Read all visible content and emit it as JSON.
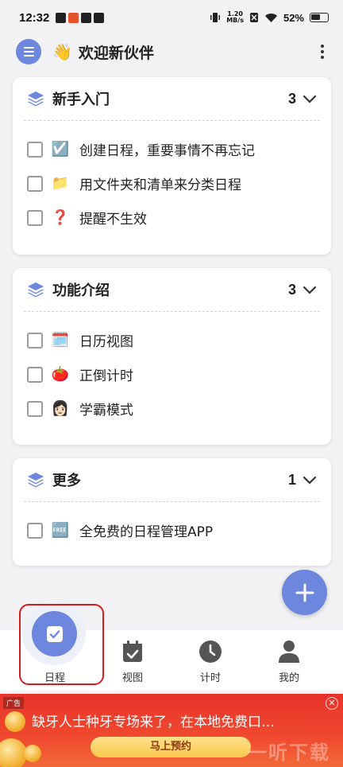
{
  "status_bar": {
    "time": "12:32",
    "net_speed_value": "1.20",
    "net_speed_unit": "MB/s",
    "battery": "52%"
  },
  "app_bar": {
    "wave_emoji": "👋",
    "title": "欢迎新伙伴",
    "menu_icon": "hamburger-icon",
    "more_icon": "more-vert-icon"
  },
  "sections": [
    {
      "title": "新手入门",
      "count": "3",
      "items": [
        {
          "emoji": "☑️",
          "label": "创建日程，重要事情不再忘记"
        },
        {
          "emoji": "📁",
          "label": "用文件夹和清单来分类日程"
        },
        {
          "emoji": "❓",
          "label": "提醒不生效"
        }
      ]
    },
    {
      "title": "功能介绍",
      "count": "3",
      "items": [
        {
          "emoji": "🗓️",
          "label": "日历视图"
        },
        {
          "emoji": "🍅",
          "label": "正倒计时"
        },
        {
          "emoji": "👩🏻",
          "label": "学霸模式"
        }
      ]
    },
    {
      "title": "更多",
      "count": "1",
      "items": [
        {
          "emoji": "🆓",
          "label": "全免费的日程管理APP"
        }
      ]
    }
  ],
  "bottom_nav": [
    {
      "label": "日程",
      "icon": "schedule-check-icon",
      "active": true
    },
    {
      "label": "视图",
      "icon": "calendar-icon"
    },
    {
      "label": "计时",
      "icon": "clock-icon"
    },
    {
      "label": "我的",
      "icon": "person-icon"
    }
  ],
  "ad": {
    "tag": "广告",
    "text": "缺牙人士种牙专场来了，在本地免费口…",
    "cta": "马上预约",
    "watermark": "一听下载"
  },
  "colors": {
    "accent": "#6d86de",
    "highlight_box": "#d41c1c",
    "ad_red": "#e8322a"
  }
}
